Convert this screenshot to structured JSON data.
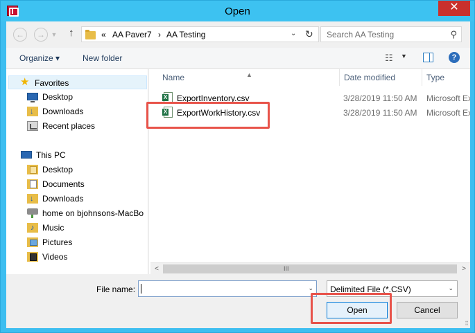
{
  "window": {
    "title": "Open",
    "close_glyph": "✕"
  },
  "address": {
    "overflow": "«",
    "crumbs": [
      "AA Paver7",
      "AA Testing"
    ],
    "separator": "›",
    "back_glyph": "←",
    "forward_glyph": "→",
    "up_glyph": "↑",
    "dropdown_glyph": "⌄",
    "refresh_glyph": "↻"
  },
  "search": {
    "placeholder": "Search AA Testing",
    "icon_glyph": "⚲"
  },
  "toolbar": {
    "organize_label": "Organize ▾",
    "new_folder_label": "New folder",
    "view_glyph": "☷",
    "view_drop_glyph": "▼",
    "help_glyph": "?"
  },
  "nav": {
    "favorites": "Favorites",
    "favorite_items": [
      "Desktop",
      "Downloads",
      "Recent places"
    ],
    "this_pc": "This PC",
    "pc_items": [
      "Desktop",
      "Documents",
      "Downloads",
      "home on bjohnsons-MacBo",
      "Music",
      "Pictures",
      "Videos"
    ]
  },
  "columns": {
    "name": "Name",
    "date_modified": "Date modified",
    "type": "Type",
    "sort_glyph": "▲"
  },
  "files": [
    {
      "name": "ExportInventory.csv",
      "date": "3/28/2019 11:50 AM",
      "type": "Microsoft Ex"
    },
    {
      "name": "ExportWorkHistory.csv",
      "date": "3/28/2019 11:50 AM",
      "type": "Microsoft Ex"
    }
  ],
  "scrollbar": {
    "left_glyph": "<",
    "right_glyph": ">",
    "grip_glyph": "III"
  },
  "bottom": {
    "file_name_label": "File name:",
    "file_name_value": "",
    "file_name_drop_glyph": "⌄",
    "filter_value": "Delimited File (*.CSV)",
    "filter_drop_glyph": "⌄",
    "open_label": "Open",
    "cancel_label": "Cancel",
    "resize_glyph": "⠿"
  },
  "colors": {
    "title_bar": "#3dc2f1",
    "close_button": "#c9302c",
    "highlight": "#e8534a",
    "excel_green": "#1f7244"
  }
}
